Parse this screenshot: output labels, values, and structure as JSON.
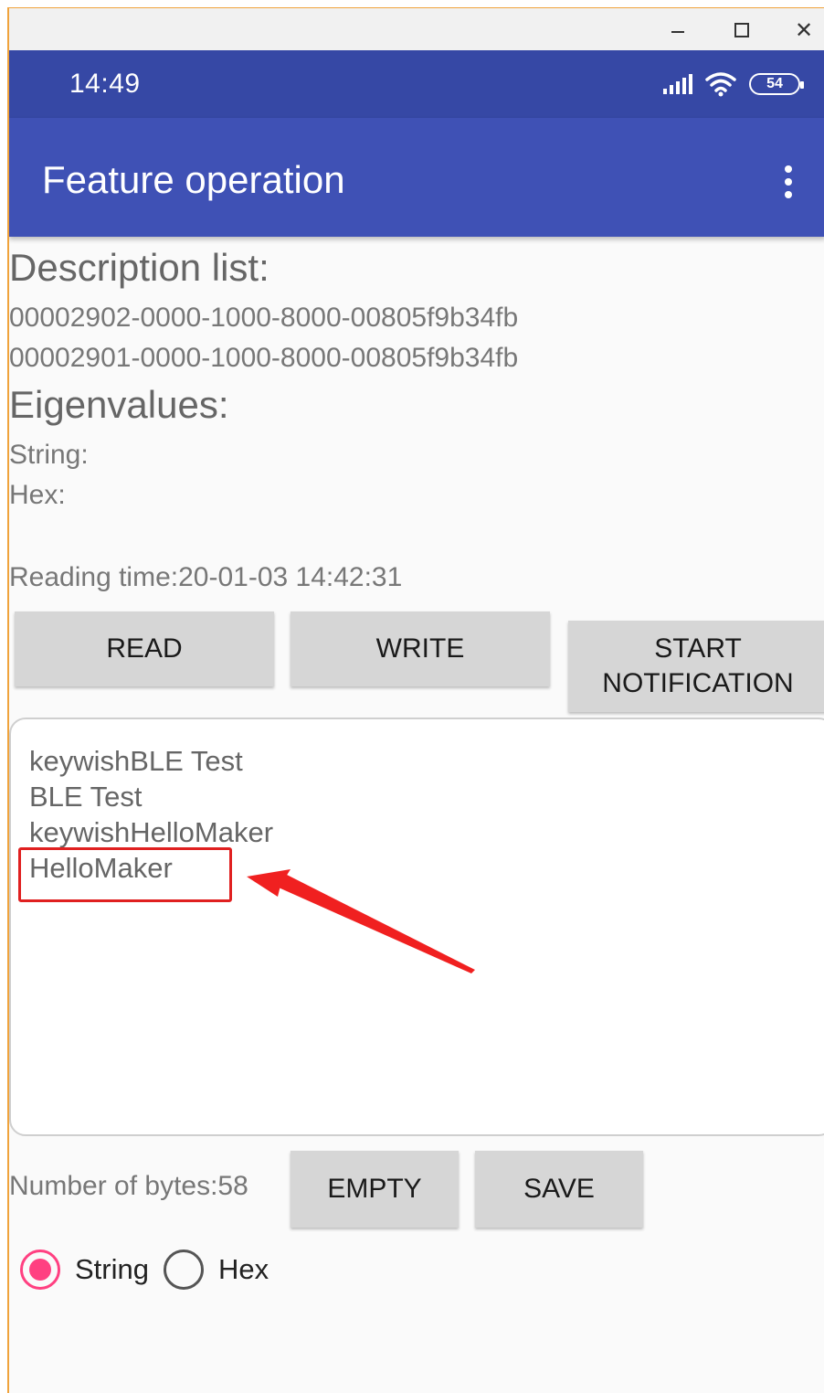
{
  "window": {
    "minimize_label": "",
    "maximize_label": "",
    "close_label": "✕"
  },
  "status_bar": {
    "time": "14:49",
    "battery": "54"
  },
  "app_bar": {
    "title": "Feature operation"
  },
  "description": {
    "title": "Description list:",
    "items": [
      "00002902-0000-1000-8000-00805f9b34fb",
      "00002901-0000-1000-8000-00805f9b34fb"
    ]
  },
  "eigenvalues": {
    "title": "Eigenvalues:",
    "string_label": "String:",
    "hex_label": "Hex:"
  },
  "reading_time": "Reading time:20-01-03 14:42:31",
  "buttons": {
    "read": "READ",
    "write": "WRITE",
    "start_notification_line1": "START",
    "start_notification_line2": "NOTIFICATION",
    "empty": "EMPTY",
    "save": "SAVE"
  },
  "log": {
    "lines": [
      "keywishBLE Test",
      "BLE Test",
      "keywishHelloMaker",
      "HelloMaker"
    ]
  },
  "bytes_count": "Number of bytes:58",
  "format_options": {
    "string": "String",
    "hex": "Hex",
    "selected": "String"
  },
  "colors": {
    "status_bar": "#3648a5",
    "app_bar": "#3f51b5",
    "radio_accent": "#ff4081",
    "annotation": "#e02020"
  }
}
